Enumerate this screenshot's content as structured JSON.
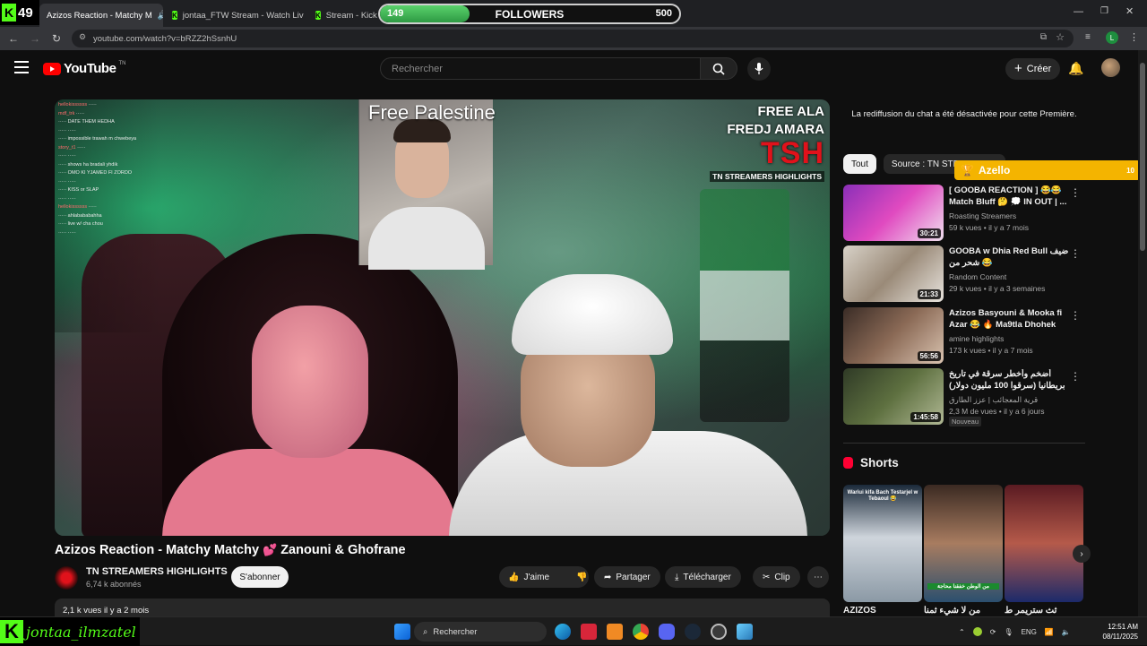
{
  "browser": {
    "tabs": [
      {
        "label": "Azizos Reaction - Matchy M",
        "active": true
      },
      {
        "label": "jontaa_FTW Stream - Watch Liv",
        "active": false
      },
      {
        "label": "Stream - Kick De",
        "active": false
      }
    ],
    "url": "youtube.com/watch?v=bRZZ2hSsnhU"
  },
  "overlay": {
    "kick_count": "49",
    "followers_current": "149",
    "followers_label": "FOLLOWERS",
    "followers_goal": "500",
    "followers_progress": 0.298,
    "azello_name": "Azello",
    "azello_count": "10",
    "kick_username": "jontaa_ilmzatel"
  },
  "youtube": {
    "logo_text": "YouTube",
    "logo_country": "TN",
    "search_placeholder": "Rechercher",
    "create_label": "Créer"
  },
  "video": {
    "overlay_title": "Free Palestine",
    "tsh_line1": "FREE ALA",
    "tsh_line2": "FREDJ AMARA",
    "tsh_logo": "TSH",
    "tsh_sub": "TN STREAMERS HIGHLIGHTS",
    "title": "Azizos Reaction - Matchy Matchy",
    "title_suffix": "Zanouni & Ghofrane",
    "channel_name": "TN STREAMERS HIGHLIGHTS",
    "subscribers": "6,74 k abonnés",
    "subscribe_label": "S'abonner",
    "like_label": "J'aime",
    "share_label": "Partager",
    "download_label": "Télécharger",
    "clip_label": "Clip",
    "description_meta": "2,1 k vues  il y a 2 mois"
  },
  "sidebar": {
    "chat_disabled": "La rediffusion du chat a été désactivée pour cette Première.",
    "chips": [
      "Tout",
      "Source : TN STREAMERS"
    ],
    "recommendations": [
      {
        "title": "[ GOOBA REACTION ] 😂😂 Match Bluff 🤔 💭 IN OUT | ...",
        "channel": "Roasting Streamers",
        "meta": "59 k vues • il y a 7 mois",
        "duration": "30:21",
        "badge": ""
      },
      {
        "title": "GOOBA w Dhia Red Bull ضيف شحر من 😂",
        "channel": "Random Content",
        "meta": "29 k vues • il y a 3 semaines",
        "duration": "21:33",
        "badge": ""
      },
      {
        "title": "Azizos Basyouni & Mooka fi Azar 😂 🔥 Ma9tla Dhohek M3...",
        "channel": "amine highlights",
        "meta": "173 k vues • il y a 7 mois",
        "duration": "56:56",
        "badge": ""
      },
      {
        "title": "أضخم وأخطر سرقة في تاريخ بريطانيا (سرقوا 100 مليون دولار)",
        "channel": "قرية المعجائب | عزز الطارق",
        "meta": "2,3 M de vues • il y a 6 jours",
        "duration": "1:45:58",
        "badge": "Nouveau"
      }
    ],
    "shorts_label": "Shorts",
    "shorts": [
      {
        "caption": "Wariui kifa Bach Testarjel w Tebaoul 😂",
        "title": "AZIZOS"
      },
      {
        "caption": "من الوطن خفقنا محاجة",
        "title": "من لا شيء ثمنا"
      },
      {
        "caption": "",
        "title": "ثث ستريمر ط"
      }
    ]
  },
  "taskbar": {
    "search_label": "Rechercher",
    "lang": "ENG",
    "time": "12:51 AM",
    "date": "08/11/2025"
  }
}
